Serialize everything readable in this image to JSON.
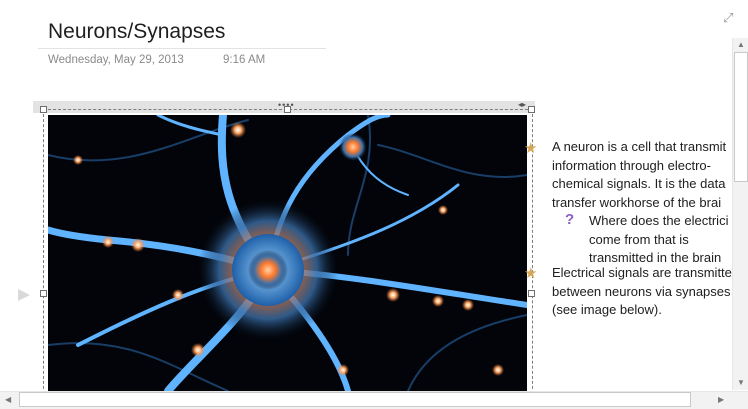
{
  "page": {
    "title": "Neurons/Synapses",
    "date": "Wednesday, May 29, 2013",
    "time": "9:16 AM"
  },
  "notes": [
    {
      "type": "star",
      "lines": [
        "A neuron is a cell that transmit",
        "information through electro-",
        "chemical signals. It is the data",
        "transfer workhorse of the brai"
      ]
    },
    {
      "type": "question",
      "lines": [
        "Where does the electrici",
        "come from that is",
        "transmitted in the brain"
      ]
    },
    {
      "type": "star",
      "lines": [
        "Electrical signals are transmitte",
        "between neurons via synapses",
        "(see image below)."
      ]
    }
  ],
  "icons": {
    "star": "star-icon",
    "question": "question-icon",
    "expand": "expand-icon"
  },
  "colors": {
    "star": "#d7a758",
    "question": "#8a5fbf",
    "neuron_glow": "#5fb3ff",
    "nucleus": "#ff7a2e"
  }
}
